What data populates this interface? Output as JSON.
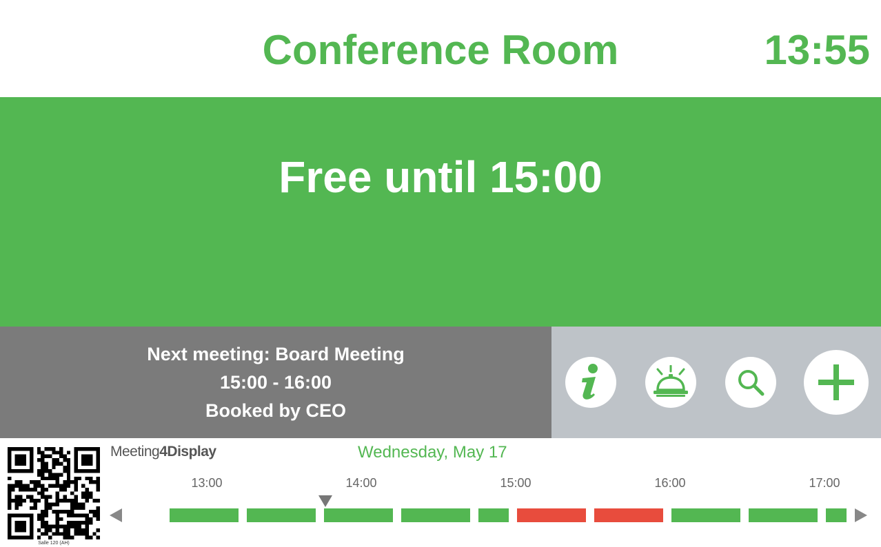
{
  "header": {
    "room_name": "Conference Room",
    "clock": "13:55"
  },
  "status": {
    "text": "Free until 15:00"
  },
  "next_meeting": {
    "title_line": "Next meeting: Board Meeting",
    "time_line": "15:00 - 16:00",
    "booked_line": "Booked by CEO"
  },
  "actions": [
    {
      "name": "info",
      "icon": "info-icon"
    },
    {
      "name": "service",
      "icon": "service-bell-icon"
    },
    {
      "name": "search",
      "icon": "search-icon"
    },
    {
      "name": "add",
      "icon": "plus-icon"
    }
  ],
  "qr": {
    "label": "Salle 120 (AH)"
  },
  "brand": {
    "part1": "Meeting",
    "part2": "4",
    "part3": "Display"
  },
  "timeline": {
    "date": "Wednesday, May 17",
    "ticks": [
      "13:00",
      "14:00",
      "15:00",
      "16:00",
      "17:00"
    ],
    "slot_minutes": 15,
    "slots": [
      {
        "start": "12:45",
        "status": "free"
      },
      {
        "start": "13:00",
        "status": "free"
      },
      {
        "start": "13:15",
        "status": "free"
      },
      {
        "start": "13:30",
        "status": "free"
      },
      {
        "start": "13:45",
        "status": "free"
      },
      {
        "start": "14:00",
        "status": "free"
      },
      {
        "start": "14:15",
        "status": "free"
      },
      {
        "start": "14:30",
        "status": "free"
      },
      {
        "start": "14:45",
        "status": "free"
      },
      {
        "start": "15:00",
        "status": "booked"
      },
      {
        "start": "15:15",
        "status": "booked"
      },
      {
        "start": "15:30",
        "status": "booked"
      },
      {
        "start": "15:45",
        "status": "booked"
      },
      {
        "start": "16:00",
        "status": "free"
      },
      {
        "start": "16:15",
        "status": "free"
      },
      {
        "start": "16:30",
        "status": "free"
      },
      {
        "start": "16:45",
        "status": "free"
      },
      {
        "start": "17:00",
        "status": "free"
      }
    ],
    "current_time": "13:55"
  },
  "colors": {
    "accent_green": "#53b752",
    "booked_red": "#e84c3d",
    "next_panel_gray": "#7b7b7b",
    "actions_panel_gray": "#bec3c8",
    "white": "#ffffff"
  }
}
